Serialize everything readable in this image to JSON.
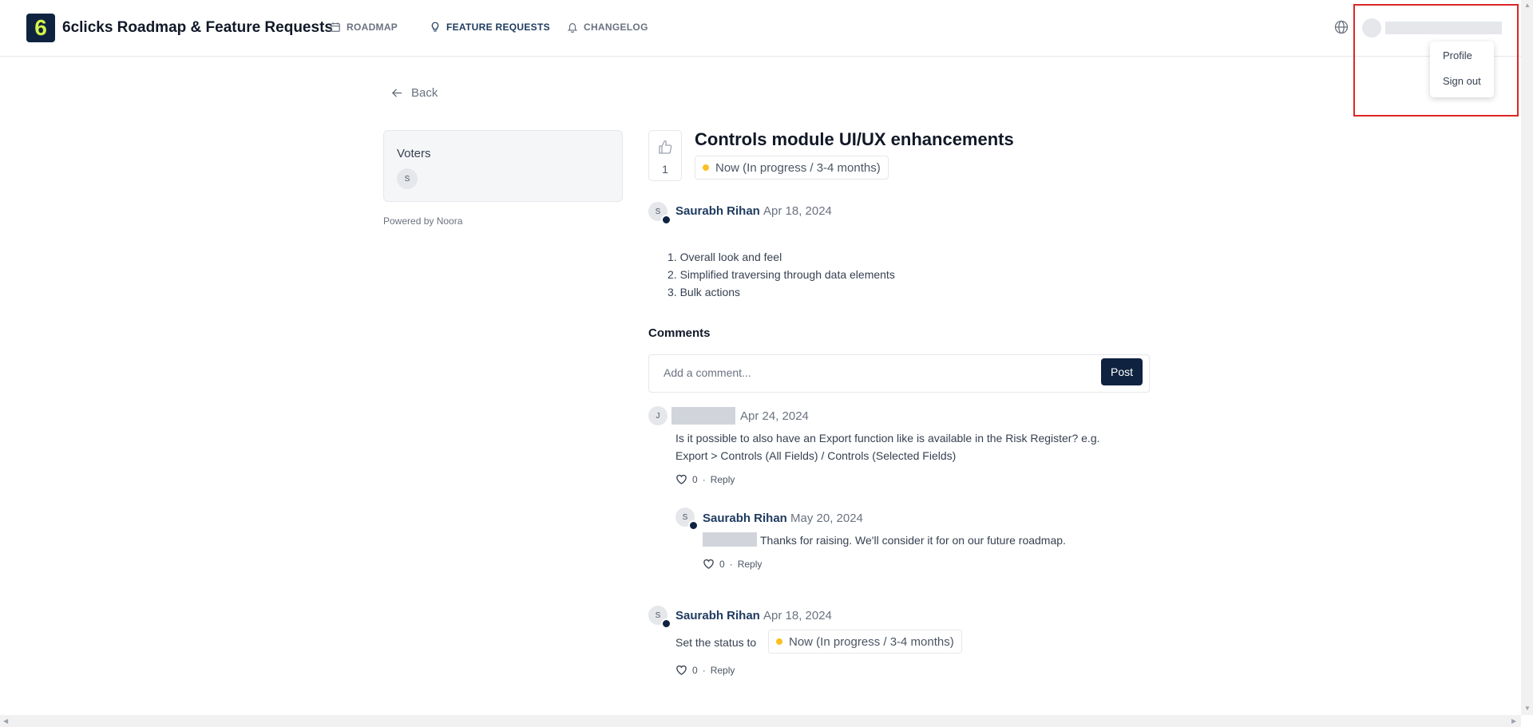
{
  "header": {
    "logo_glyph": "6",
    "site_title": "6clicks Roadmap & Feature Requests",
    "nav": [
      {
        "label": "ROADMAP",
        "icon": "calendar-icon"
      },
      {
        "label": "FEATURE REQUESTS",
        "icon": "lightbulb-icon"
      },
      {
        "label": "CHANGELOG",
        "icon": "bell-icon"
      }
    ],
    "active_nav": "FEATURE REQUESTS"
  },
  "user_menu": {
    "items": [
      "Profile",
      "Sign out"
    ]
  },
  "back_label": "Back",
  "voters": {
    "title": "Voters",
    "list": [
      "S"
    ]
  },
  "powered_by": "Powered by Noora",
  "post": {
    "votes": "1",
    "title": "Controls module UI/UX enhancements",
    "status": "Now (In progress / 3-4 months)",
    "author_initial": "S",
    "author": "Saurabh Rihan",
    "date": "Apr 18, 2024",
    "description": [
      "1. Overall look and feel",
      "2. Simplified traversing through data elements",
      "3. Bulk actions"
    ]
  },
  "comments": {
    "heading": "Comments",
    "placeholder": "Add a comment...",
    "post_label": "Post",
    "reply_label": "Reply",
    "items": [
      {
        "initial": "J",
        "date": "Apr 24, 2024",
        "text_line1": "Is it possible to also have an Export function like is available in the Risk Register? e.g.",
        "text_line2": "Export > Controls (All Fields) / Controls (Selected Fields)",
        "likes": "0"
      },
      {
        "initial": "S",
        "author": "Saurabh Rihan",
        "date": "May 20, 2024",
        "text": "Thanks for raising. We'll consider it for on our future roadmap.",
        "likes": "0"
      },
      {
        "initial": "S",
        "author": "Saurabh Rihan",
        "date": "Apr 18, 2024",
        "text": "Set the status to",
        "status": "Now (In progress / 3-4 months)",
        "likes": "0"
      }
    ]
  },
  "colors": {
    "brand_navy": "#0f2340",
    "logo_accent": "#d6f34a",
    "status_dot": "#fbbf24",
    "highlight_red": "#dc2626"
  }
}
